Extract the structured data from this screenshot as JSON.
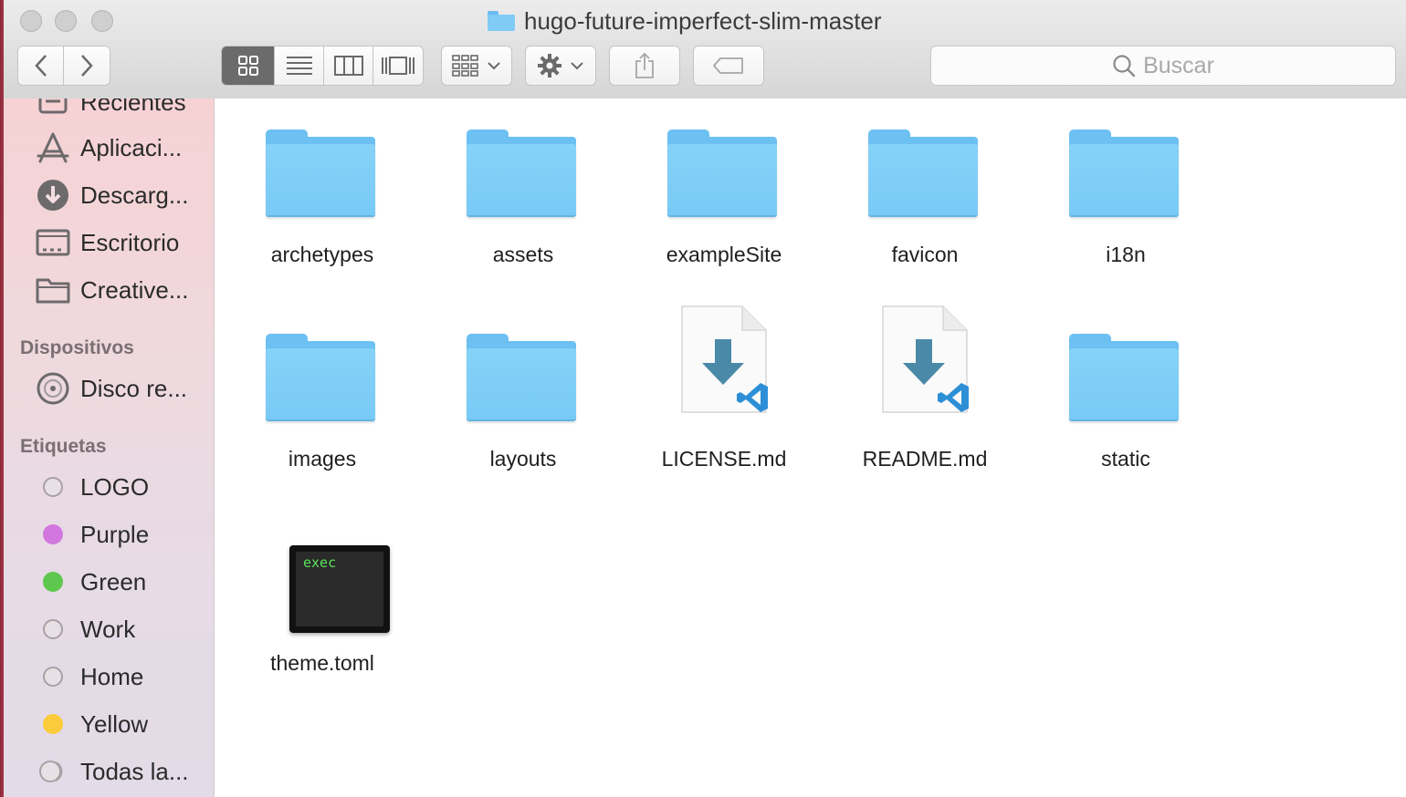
{
  "window": {
    "title": "hugo-future-imperfect-slim-master"
  },
  "toolbar": {
    "search_placeholder": "Buscar"
  },
  "sidebar": {
    "favorites": [
      {
        "label": "Recientes",
        "icon": "recents-icon"
      },
      {
        "label": "Aplicaci...",
        "icon": "applications-icon"
      },
      {
        "label": "Descarg...",
        "icon": "downloads-icon"
      },
      {
        "label": "Escritorio",
        "icon": "desktop-icon"
      },
      {
        "label": "Creative...",
        "icon": "folder-icon"
      }
    ],
    "devices_header": "Dispositivos",
    "devices": [
      {
        "label": "Disco re...",
        "icon": "disc-icon"
      }
    ],
    "tags_header": "Etiquetas",
    "tags": [
      {
        "label": "LOGO",
        "color": "#e8e0e4"
      },
      {
        "label": "Purple",
        "color": "#d277e0"
      },
      {
        "label": "Green",
        "color": "#5ec84e"
      },
      {
        "label": "Work",
        "color": "#e8e0e4"
      },
      {
        "label": "Home",
        "color": "#e8e0e4"
      },
      {
        "label": "Yellow",
        "color": "#fccb3b"
      },
      {
        "label": "Todas la...",
        "color": "#e8e0e4"
      }
    ]
  },
  "files": [
    {
      "name": "archetypes",
      "type": "folder"
    },
    {
      "name": "assets",
      "type": "folder"
    },
    {
      "name": "exampleSite",
      "type": "folder"
    },
    {
      "name": "favicon",
      "type": "folder"
    },
    {
      "name": "i18n",
      "type": "folder"
    },
    {
      "name": "images",
      "type": "folder"
    },
    {
      "name": "layouts",
      "type": "folder"
    },
    {
      "name": "LICENSE.md",
      "type": "vscode-document"
    },
    {
      "name": "README.md",
      "type": "vscode-document"
    },
    {
      "name": "static",
      "type": "folder"
    },
    {
      "name": "theme.toml",
      "type": "exec",
      "badge": "exec"
    }
  ]
}
